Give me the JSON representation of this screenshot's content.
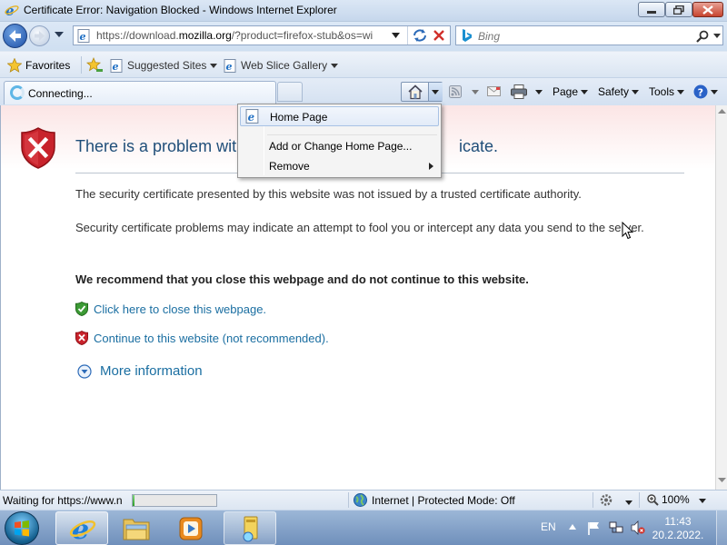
{
  "window": {
    "title": "Certificate Error: Navigation Blocked - Windows Internet Explorer",
    "controls": {
      "minimize": "minimize",
      "maximize": "maximize",
      "close": "close"
    }
  },
  "address": {
    "url_prefix": "https://download.",
    "url_domain": "mozilla.org",
    "url_suffix": "/?product=firefox-stub&os=wi"
  },
  "search": {
    "placeholder": "Bing"
  },
  "favorites_bar": {
    "favorites_label": "Favorites",
    "items": [
      {
        "label": "Suggested Sites"
      },
      {
        "label": "Web Slice Gallery"
      }
    ]
  },
  "tab": {
    "label": "Connecting..."
  },
  "command_bar": {
    "page": "Page",
    "safety": "Safety",
    "tools": "Tools"
  },
  "home_menu": {
    "items": [
      {
        "label": "Home Page"
      },
      {
        "label": "Add or Change Home Page..."
      },
      {
        "label": "Remove"
      }
    ]
  },
  "content": {
    "title_start": "There is a problem with",
    "title_end": "icate.",
    "para1": "The security certificate presented by this website was not issued by a trusted certificate authority.",
    "para2": "Security certificate problems may indicate an attempt to fool you or intercept any data you send to the server.",
    "recommend": "We recommend that you close this webpage and do not continue to this website.",
    "close_link": "Click here to close this webpage.",
    "continue_link": "Continue to this website (not recommended).",
    "more_info": "More information"
  },
  "status": {
    "waiting": "Waiting for https://www.n",
    "progress": 0.02,
    "zone": "Internet | Protected Mode: Off",
    "zoom": "100%"
  },
  "taskbar": {
    "language": "EN",
    "time": "11:43",
    "date": "20.2.2022."
  },
  "colors": {
    "link": "#1a6ea1",
    "title": "#1f4e79",
    "shield_red": "#c8232c",
    "shield_green": "#3c9a35"
  }
}
